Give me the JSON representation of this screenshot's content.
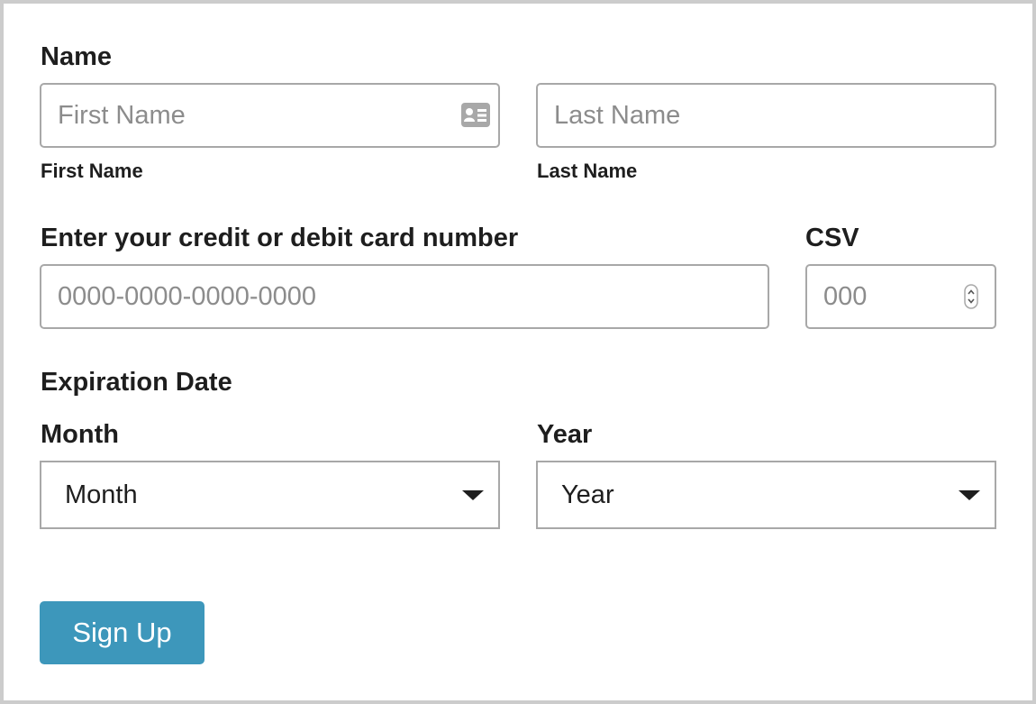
{
  "form": {
    "name_heading": "Name",
    "first_name": {
      "placeholder": "First Name",
      "caption": "First Name",
      "icon": "contact-card-icon"
    },
    "last_name": {
      "placeholder": "Last Name",
      "caption": "Last Name"
    },
    "card_number": {
      "label": "Enter your credit or debit card number",
      "placeholder": "0000-0000-0000-0000"
    },
    "csv": {
      "label": "CSV",
      "placeholder": "000",
      "icon": "spinner-arrows-icon"
    },
    "expiration_heading": "Expiration Date",
    "month": {
      "label": "Month",
      "selected": "Month",
      "icon": "caret-down-icon"
    },
    "year": {
      "label": "Year",
      "selected": "Year",
      "icon": "caret-down-icon"
    },
    "submit_label": "Sign Up"
  },
  "colors": {
    "button_bg": "#3d97bb",
    "border": "#a8a8a8",
    "frame_border": "#cccccc",
    "text": "#1e1e1e",
    "placeholder": "#8c8c8c"
  }
}
